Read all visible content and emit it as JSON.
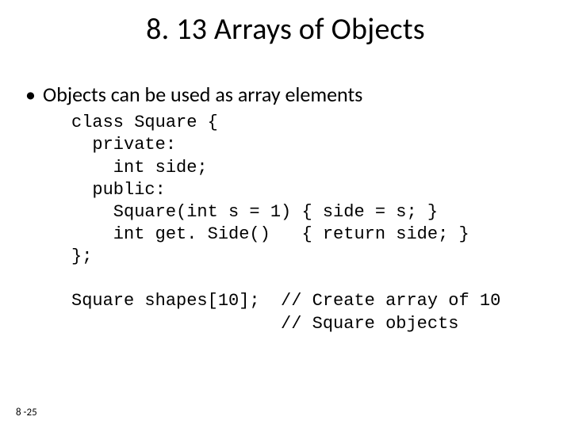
{
  "title": "8. 13 Arrays of Objects",
  "bullet_text": "Objects can be used as array elements",
  "code_lines": [
    "class Square {",
    "  private:",
    "    int side;",
    "  public:",
    "    Square(int s = 1) { side = s; }",
    "    int get. Side()   { return side; }",
    "};",
    "",
    "Square shapes[10];  // Create array of 10",
    "                    // Square objects"
  ],
  "footer": "8 -25"
}
